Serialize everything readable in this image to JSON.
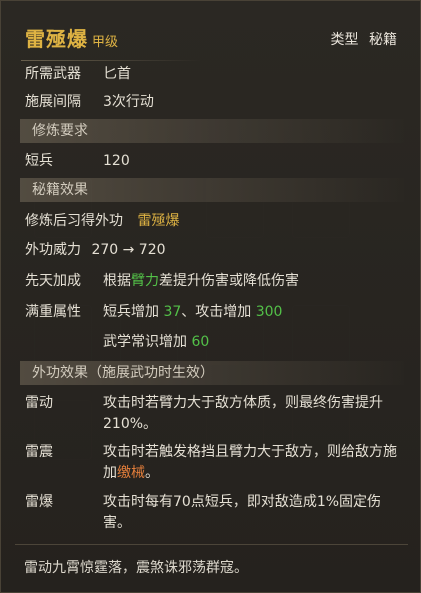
{
  "header": {
    "title": "雷殛爆",
    "grade": "甲级",
    "type_label": "类型",
    "type_value": "秘籍"
  },
  "basic": {
    "weapon_label": "所需武器",
    "weapon_value": "匕首",
    "interval_label": "施展间隔",
    "interval_value": "3次行动"
  },
  "requirement": {
    "section_title": "修炼要求",
    "stat_label": "短兵",
    "stat_value": "120"
  },
  "skill_effect": {
    "section_title": "秘籍效果",
    "learn_label": "修炼后习得外功",
    "learn_value": "雷殛爆",
    "power_label": "外功威力",
    "power_value": "270 → 720",
    "bonus_label": "先天加成",
    "bonus_text_1": "根据",
    "bonus_attr": "臂力",
    "bonus_text_2": "差提升伤害或降低伤害",
    "full_label": "满重属性",
    "full_line1_a": "短兵增加 ",
    "full_line1_b": "37",
    "full_line1_c": "、攻击增加 ",
    "full_line1_d": "300",
    "full_line2_a": "武学常识增加 ",
    "full_line2_b": "60"
  },
  "outer_effect": {
    "section_title": "外功效果（施展武功时生效）",
    "effects": [
      {
        "name": "雷动",
        "text": "攻击时若臂力大于敌方体质，则最终伤害提升210%。"
      },
      {
        "name": "雷震",
        "text_a": "攻击时若触发格挡且臂力大于敌方，则给敌方施加",
        "text_b": "缴械",
        "text_c": "。"
      },
      {
        "name": "雷爆",
        "text": "攻击时每有70点短兵，即对敌造成1%固定伤害。"
      }
    ]
  },
  "flavor": "雷动九霄惊霆落，震煞诛邪荡群寇。",
  "colors": {
    "title": "#e5b845",
    "green": "#55c64a",
    "orange": "#e8813c"
  }
}
